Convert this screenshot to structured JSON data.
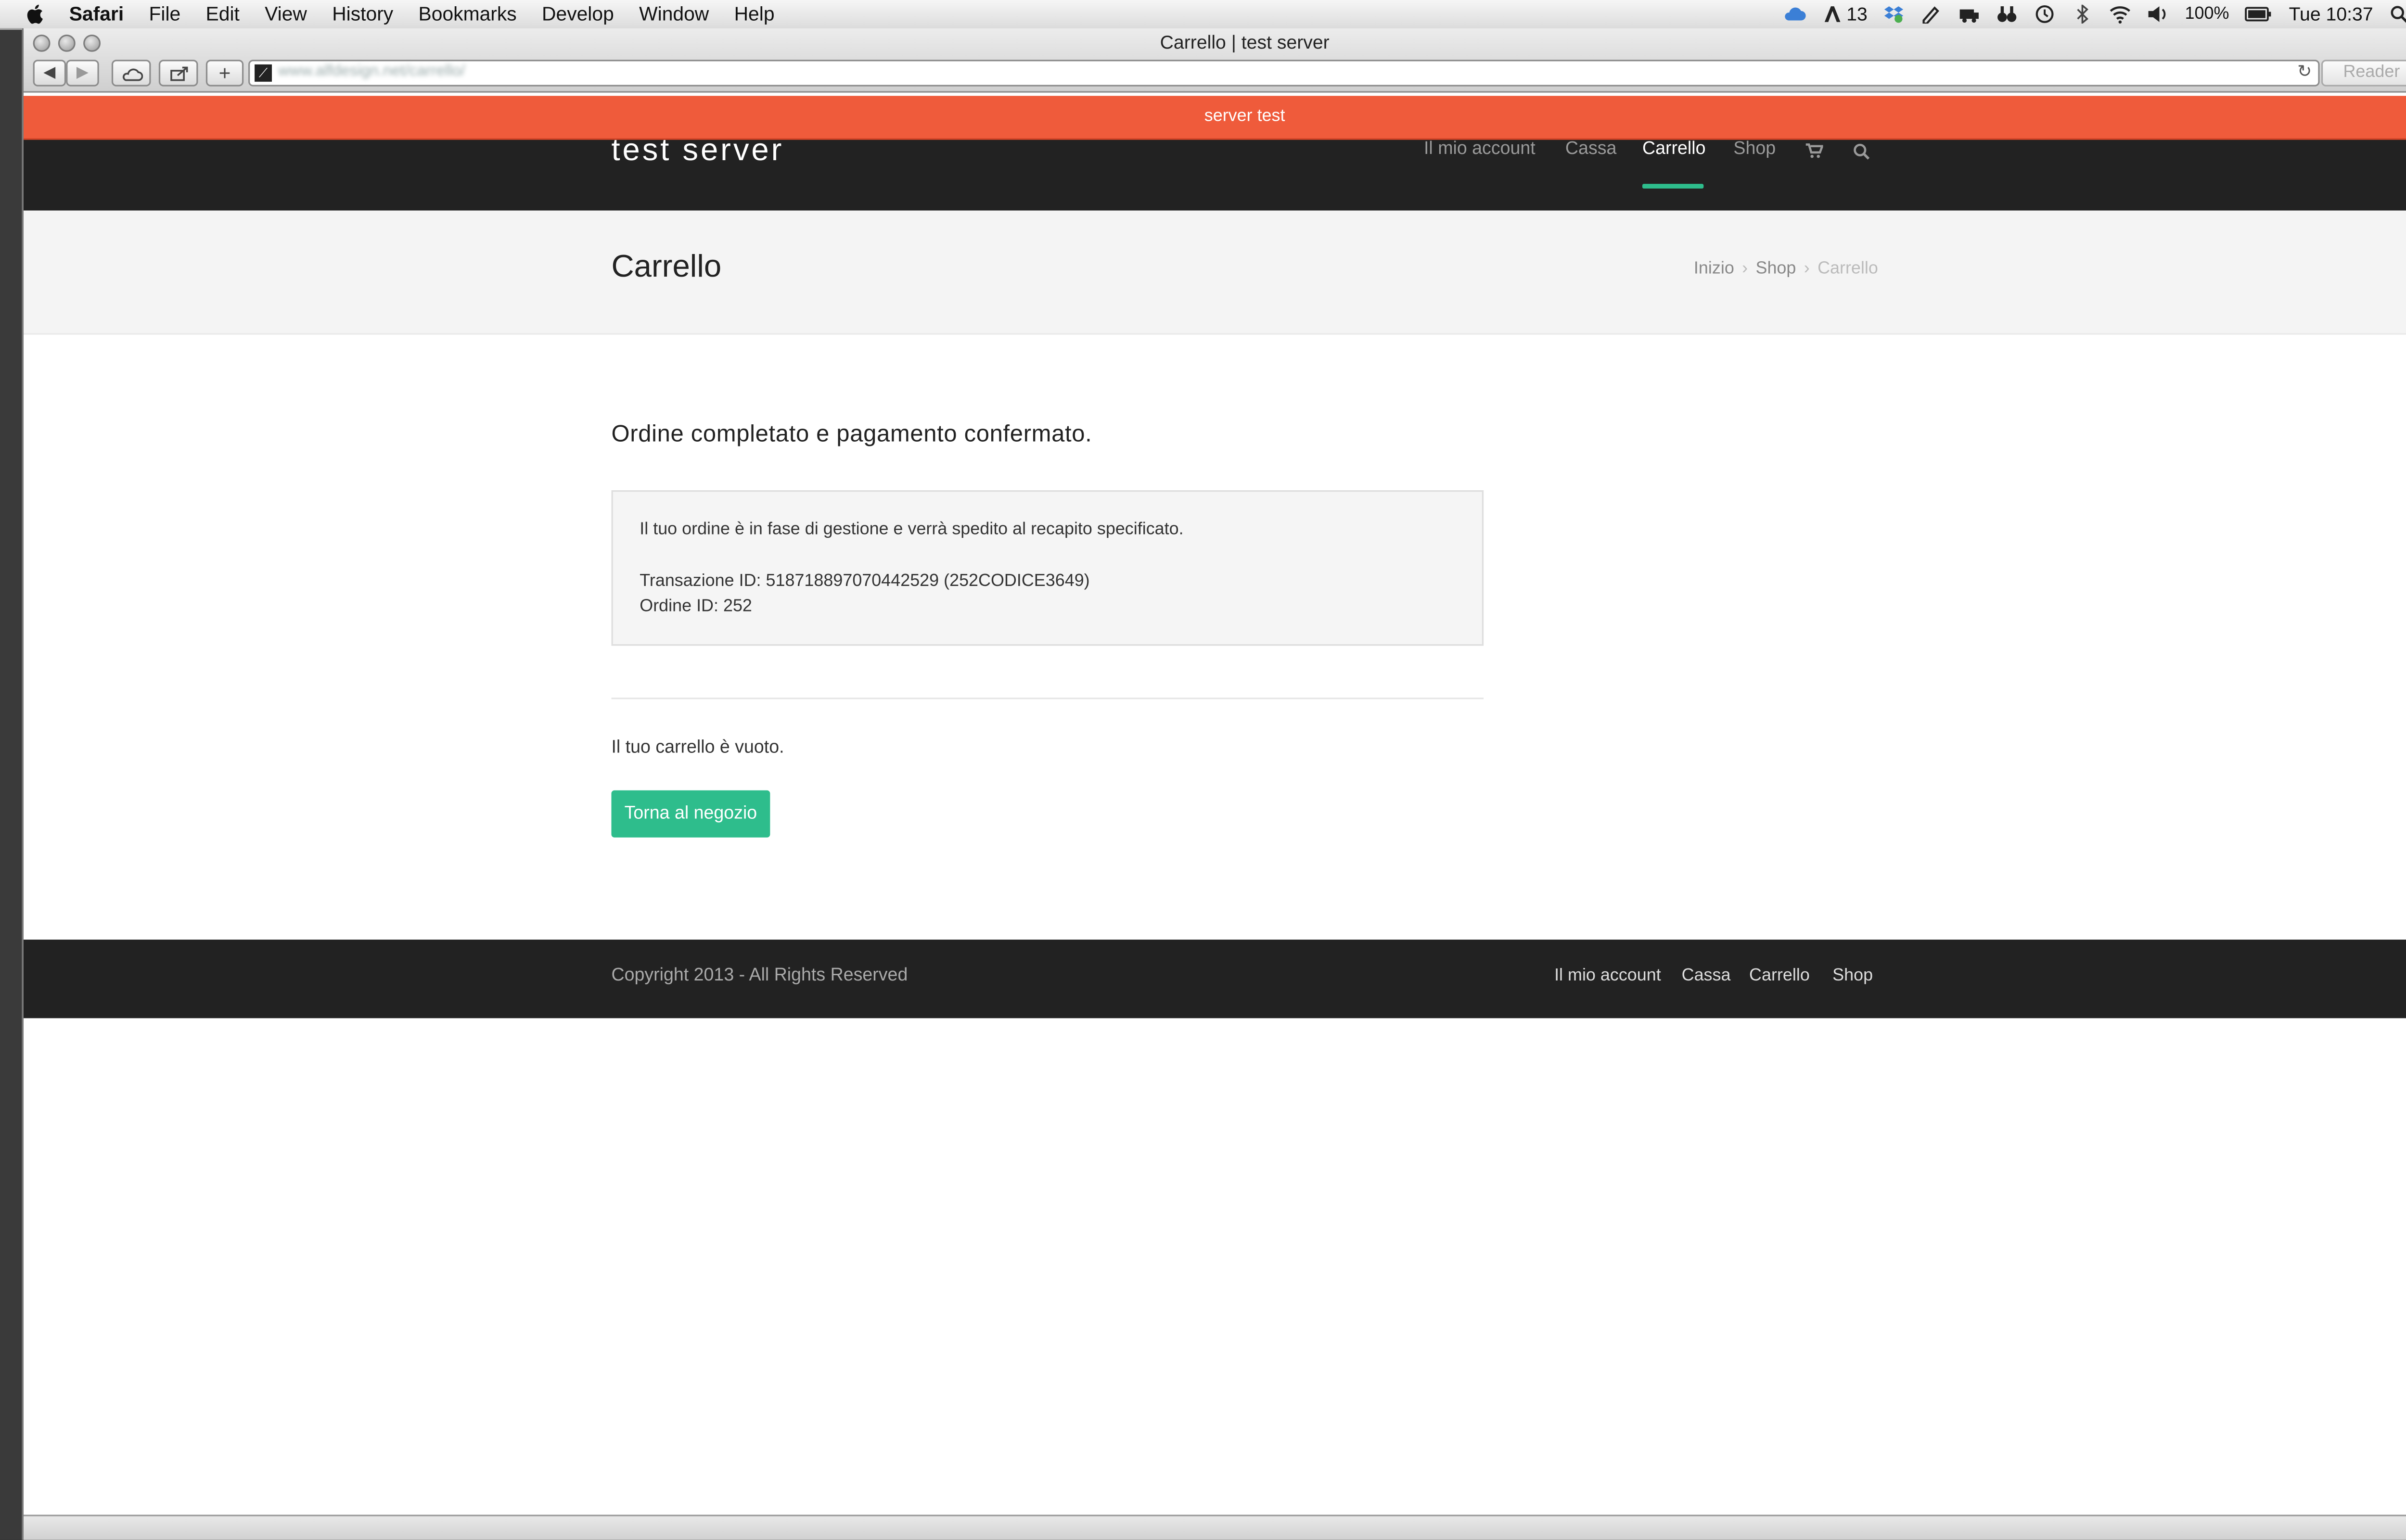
{
  "menubar": {
    "app_name": "Safari",
    "items": [
      "File",
      "Edit",
      "View",
      "History",
      "Bookmarks",
      "Develop",
      "Window",
      "Help"
    ],
    "status": {
      "notifications_count": "13",
      "battery": "100%",
      "clock": "Tue 10:37"
    }
  },
  "browser": {
    "window_title": "Carrello | test server",
    "url": "www.alfdesign.net/carrello/",
    "reader_label": "Reader"
  },
  "site": {
    "notice": "server test",
    "logo": "test server",
    "nav": [
      "Il mio account",
      "Cassa",
      "Carrello",
      "Shop"
    ],
    "active_nav": "Carrello"
  },
  "page": {
    "title": "Carrello",
    "breadcrumb": [
      "Inizio",
      "Shop",
      "Carrello"
    ],
    "order_heading": "Ordine completato e pagamento confermato.",
    "info": {
      "message": "Il tuo ordine è in fase di gestione e verrà spedito al recapito specificato.",
      "transaction": "Transazione ID: 518718897070442529 (252CODICE3649)",
      "order": "Ordine ID: 252"
    },
    "empty_cart": "Il tuo carrello è vuoto.",
    "back_button": "Torna al negozio"
  },
  "footer": {
    "copyright": "Copyright 2013 - All Rights Reserved",
    "links": [
      "Il mio account",
      "Cassa",
      "Carrello",
      "Shop"
    ]
  },
  "colors": {
    "notice_bar": "#ef5b3b",
    "accent": "#2ebd8c",
    "header_bg": "#222222"
  }
}
